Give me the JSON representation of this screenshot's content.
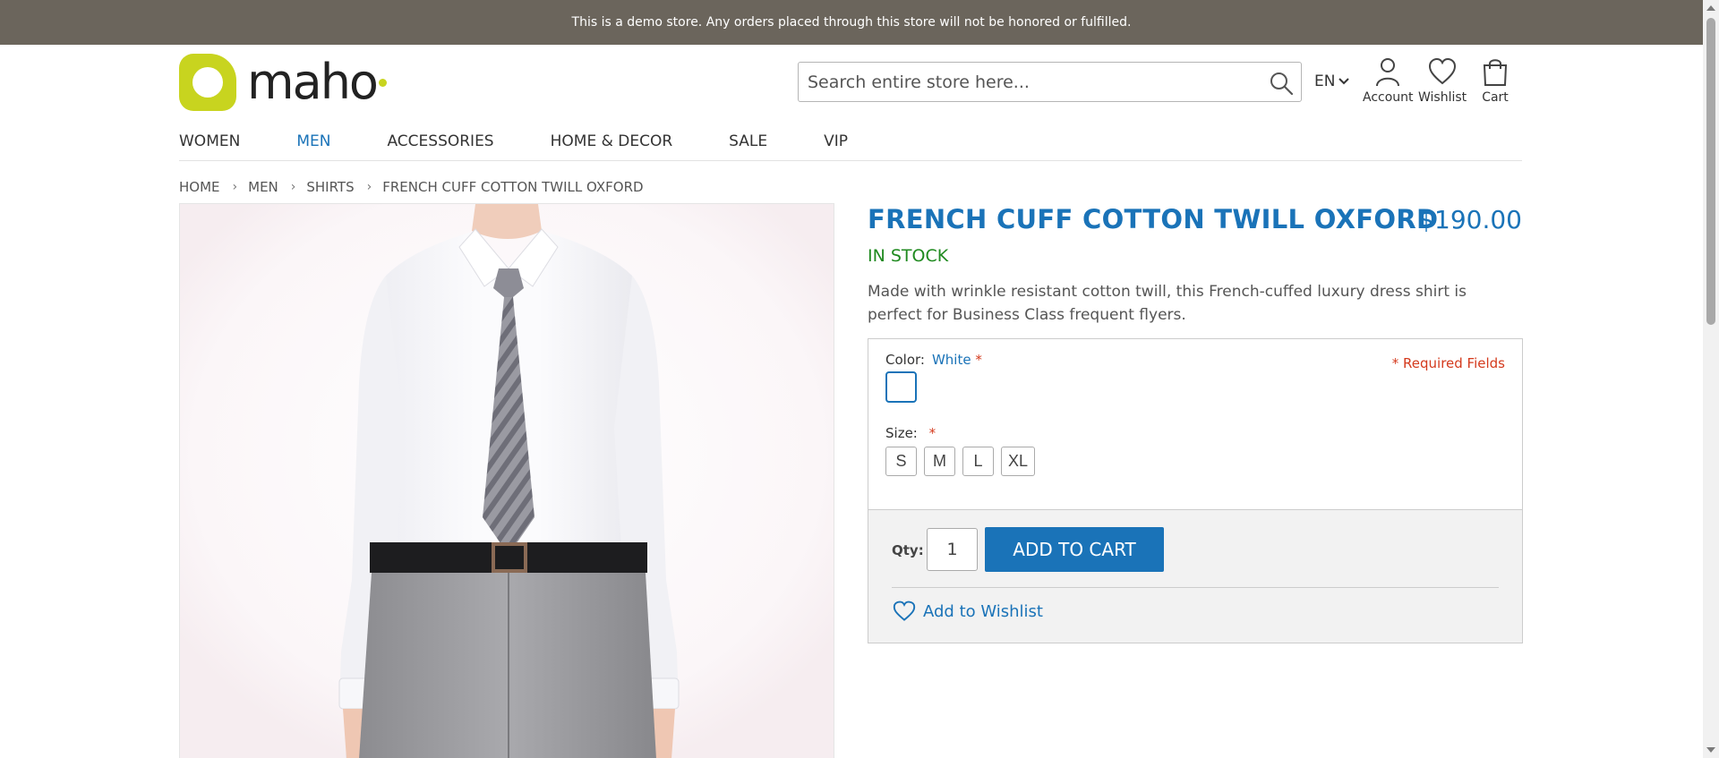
{
  "notice": "This is a demo store. Any orders placed through this store will not be honored or fulfilled.",
  "brand": {
    "name": "maho",
    "accent_color": "#c8d41f"
  },
  "search": {
    "placeholder": "Search entire store here...",
    "icon": "search-icon"
  },
  "header": {
    "language": "EN",
    "links": [
      {
        "label": "Account",
        "icon": "user-icon"
      },
      {
        "label": "Wishlist",
        "icon": "heart-icon"
      },
      {
        "label": "Cart",
        "icon": "bag-icon"
      }
    ]
  },
  "nav": {
    "items": [
      "WOMEN",
      "MEN",
      "ACCESSORIES",
      "HOME & DECOR",
      "SALE",
      "VIP"
    ],
    "active": "MEN"
  },
  "breadcrumb": [
    "HOME",
    "MEN",
    "SHIRTS",
    "FRENCH CUFF COTTON TWILL OXFORD"
  ],
  "product": {
    "title": "FRENCH CUFF COTTON TWILL OXFORD",
    "price": "$190.00",
    "stock": "IN STOCK",
    "description": "Made with wrinkle resistant cotton twill, this French-cuffed luxury dress shirt is perfect for Business Class frequent flyers."
  },
  "options": {
    "required_note": "* Required Fields",
    "color_label": "Color:",
    "color_value": "White",
    "size_label": "Size:",
    "required_mark": "*",
    "sizes": [
      "S",
      "M",
      "L",
      "XL"
    ]
  },
  "cart": {
    "qty_label": "Qty:",
    "qty_value": "1",
    "add_label": "ADD TO CART",
    "wishlist_label": "Add to Wishlist"
  },
  "colors": {
    "primary": "#1a73b8",
    "in_stock": "#1f8a1f",
    "required": "#d43a1d",
    "notice_bar": "#6b655c"
  }
}
